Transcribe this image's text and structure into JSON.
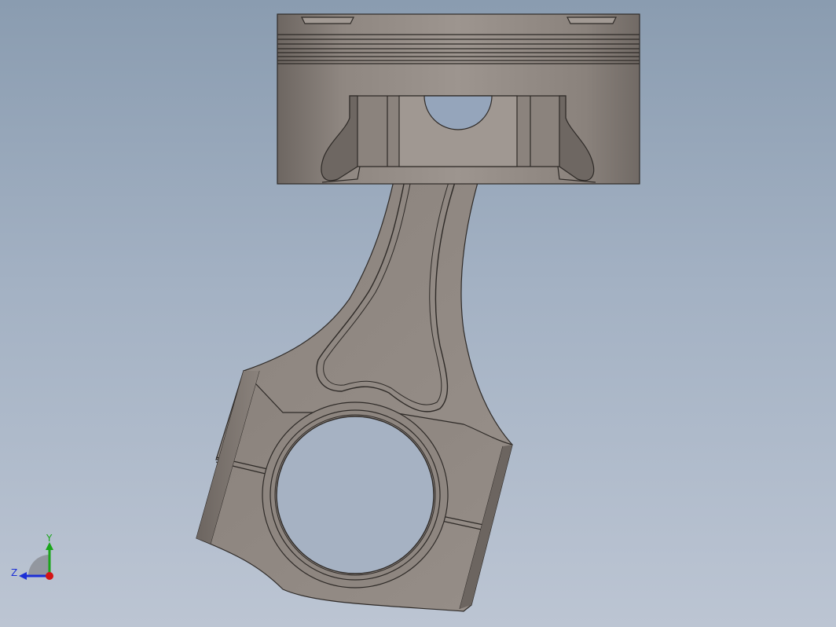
{
  "view": {
    "background_top": "#8a9cb0",
    "background_bottom": "#bcc5d3",
    "part_face_color": "#948c86",
    "part_edge_color": "#2e2a27"
  },
  "model": {
    "components": [
      "piston",
      "connecting-rod",
      "rod-cap",
      "piston-pin-bore",
      "crank-bore"
    ]
  },
  "triad": {
    "y_label": "Y",
    "z_label": "Z",
    "y_color": "#1aa51a",
    "z_color": "#1c2fd6",
    "x_color": "#d41414"
  }
}
